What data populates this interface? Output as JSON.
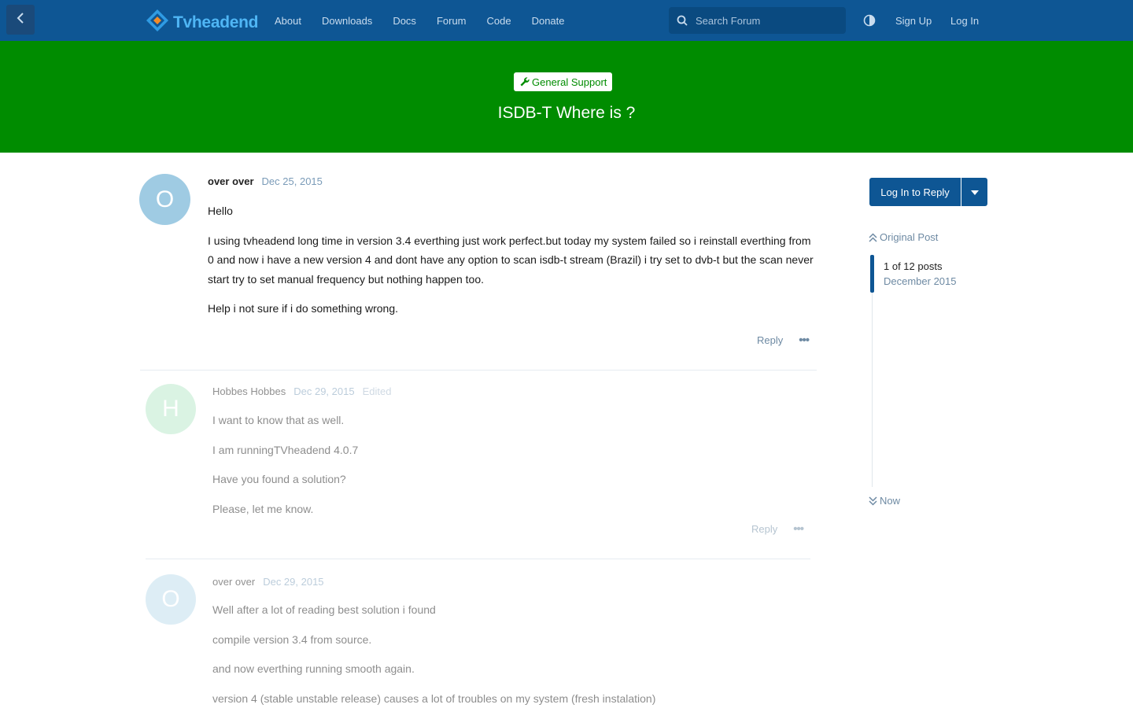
{
  "header": {
    "brand": "Tvheadend",
    "nav": [
      "About",
      "Downloads",
      "Docs",
      "Forum",
      "Code",
      "Donate"
    ],
    "search_placeholder": "Search Forum",
    "signup": "Sign Up",
    "login": "Log In",
    "colors": {
      "bar": "#0e5694",
      "brand_text": "#4fb6f5"
    }
  },
  "hero": {
    "tag": "General Support",
    "title": "ISDB-T Where is ?",
    "color": "#008c00"
  },
  "posts": [
    {
      "initial": "O",
      "author": "over over",
      "date": "Dec 25, 2015",
      "paragraphs": [
        "Hello",
        "I using tvheadend long time in version 3.4 everthing just work perfect.but today my system failed so i reinstall everthing from 0 and now i have a new version 4 and dont have any option to scan isdb-t stream (Brazil) i try set to dvb-t but the scan never start try to set manual frequency but nothing happen too.",
        "Help i not sure if i do something wrong."
      ],
      "reply": "Reply"
    },
    {
      "initial": "H",
      "author": "Hobbes Hobbes",
      "date": "Dec 29, 2015",
      "edited": "Edited",
      "paragraphs": [
        "I want to know that as well.",
        "I am runningTVheadend 4.0.7",
        "Have you found a solution?",
        "Please, let me know."
      ],
      "reply": "Reply"
    },
    {
      "initial": "O",
      "author": "over over",
      "date": "Dec 29, 2015",
      "paragraphs": [
        "Well after a lot of reading best solution i found",
        "compile version 3.4 from source.",
        "and now everthing running smooth again.",
        "version 4 (stable unstable release) causes a lot of troubles on my system (fresh instalation)"
      ]
    }
  ],
  "sidebar": {
    "reply_button": "Log In to Reply",
    "original_post": "Original Post",
    "count": "1 of 12 posts",
    "month": "December 2015",
    "now": "Now"
  }
}
